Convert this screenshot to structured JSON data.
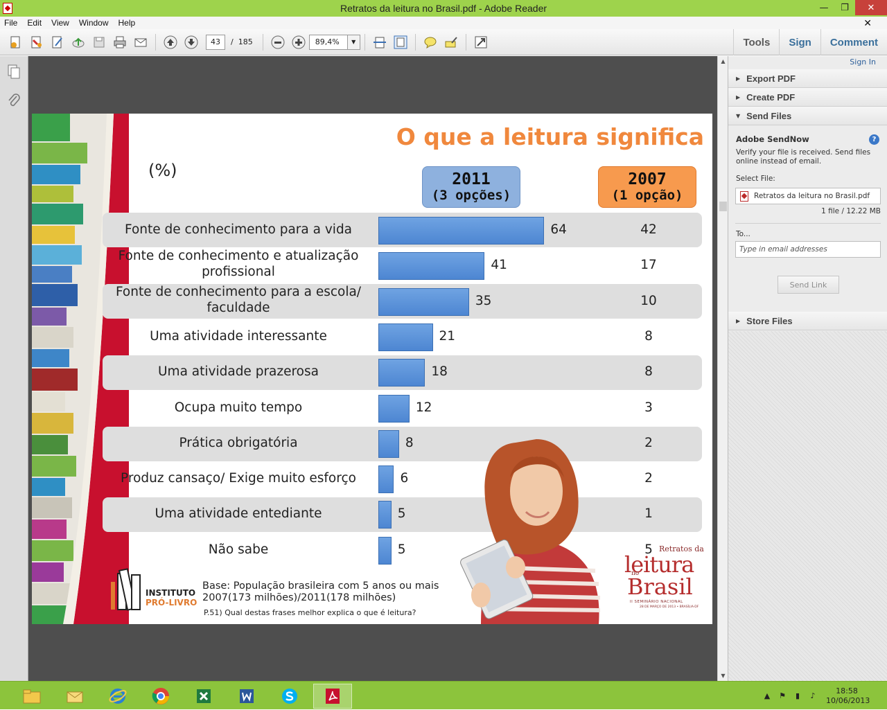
{
  "window": {
    "title": "Retratos da leitura no Brasil.pdf - Adobe Reader",
    "minimize_glyph": "—",
    "restore_glyph": "❐",
    "close_glyph": "✕"
  },
  "menu": {
    "items": [
      "File",
      "Edit",
      "View",
      "Window",
      "Help"
    ],
    "close_glyph": "✕"
  },
  "toolbar": {
    "current_page": "43",
    "page_separator": "/",
    "total_pages": "185",
    "zoom": "89,4%",
    "zoom_dropdown_glyph": "▼",
    "tools": "Tools",
    "sign": "Sign",
    "comment": "Comment"
  },
  "slide": {
    "title": "O que a leitura significa",
    "percent_label": "(%)",
    "year_2011": {
      "year": "2011",
      "sub": "(3 opções)"
    },
    "year_2007": {
      "year": "2007",
      "sub": "(1 opção)"
    },
    "base_line1": "Base: População brasileira com 5 anos ou mais",
    "base_line2": "2007(173 milhões)/2011(178 milhões)",
    "question": "P.51) Qual destas frases melhor explica o que é leitura?",
    "ipl_logo": {
      "line1": "INSTITUTO",
      "line2": "PRÓ-LIVRO"
    },
    "retratos_logo": {
      "l1": "Retratos da",
      "l2": "leitura",
      "l3": "no",
      "l4": "Brasil",
      "l5": "II SEMINÁRIO NACIONAL",
      "l6": "28 DE MARÇO DE 2013 • BRASÍLIA-DF"
    }
  },
  "chart_data": {
    "type": "bar",
    "categories": [
      "Fonte de conhecimento para a vida",
      "Fonte de conhecimento e atualização profissional",
      "Fonte de conhecimento para a escola/ faculdade",
      "Uma atividade interessante",
      "Uma atividade prazerosa",
      "Ocupa muito tempo",
      "Prática obrigatória",
      "Produz cansaço/ Exige muito esforço",
      "Uma atividade entediante",
      "Não sabe"
    ],
    "series": [
      {
        "name": "2011 (3 opções)",
        "values": [
          64,
          41,
          35,
          21,
          18,
          12,
          8,
          6,
          5,
          5
        ]
      },
      {
        "name": "2007 (1 opção)",
        "values": [
          42,
          17,
          10,
          8,
          8,
          3,
          2,
          2,
          1,
          5
        ]
      }
    ],
    "title": "O que a leitura significa",
    "ylabel": "(%)",
    "bar_color": "#5b93dc"
  },
  "right_pane": {
    "sign_in": "Sign In",
    "sections": {
      "export_pdf": "Export PDF",
      "create_pdf": "Create PDF",
      "send_files": "Send Files",
      "store_files": "Store Files"
    },
    "send_now": {
      "heading": "Adobe SendNow",
      "help_glyph": "?",
      "description": "Verify your file is received. Send files online instead of email.",
      "select_file_label": "Select File:",
      "file_name": "Retratos da leitura no Brasil.pdf",
      "file_info": "1 file / 12.22 MB",
      "to_label": "To...",
      "email_placeholder": "Type in email addresses",
      "send_link": "Send Link"
    },
    "collapsed_glyph": "▶",
    "expanded_glyph": "▼"
  },
  "taskbar": {
    "time": "18:58",
    "date": "10/06/2013",
    "apps": [
      "file-explorer",
      "outlook",
      "internet-explorer",
      "chrome",
      "excel",
      "word",
      "skype",
      "adobe-reader"
    ]
  }
}
